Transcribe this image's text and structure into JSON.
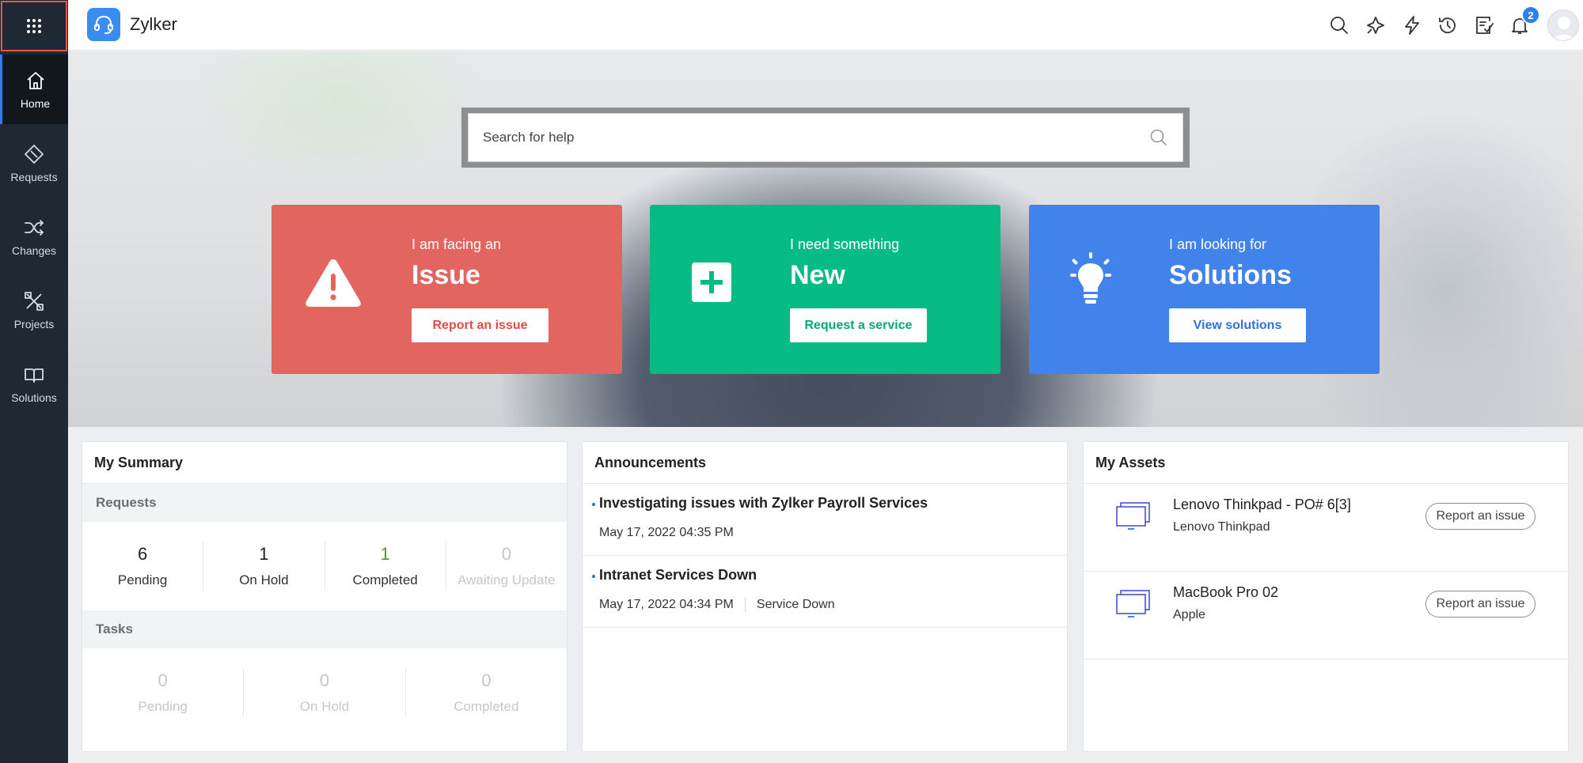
{
  "app": {
    "name": "Zylker"
  },
  "nav": {
    "items": [
      {
        "label": "Home",
        "icon": "home-icon"
      },
      {
        "label": "Requests",
        "icon": "ticket-icon"
      },
      {
        "label": "Changes",
        "icon": "shuffle-icon"
      },
      {
        "label": "Projects",
        "icon": "projects-icon"
      },
      {
        "label": "Solutions",
        "icon": "book-icon"
      }
    ],
    "active": "Home"
  },
  "header": {
    "icons": [
      "search-icon",
      "magic-icon",
      "lightning-icon",
      "history-icon",
      "checklist-icon",
      "bell-icon"
    ],
    "notifications_count": "2"
  },
  "search": {
    "placeholder": "Search for help"
  },
  "cards": [
    {
      "kicker": "I am facing an",
      "headline": "Issue",
      "button": "Report an issue",
      "icon": "warning-icon",
      "color": "#e26560"
    },
    {
      "kicker": "I need something",
      "headline": "New",
      "button": "Request a service",
      "icon": "plus-icon",
      "color": "#06bb84"
    },
    {
      "kicker": "I am looking for",
      "headline": "Solutions",
      "button": "View solutions",
      "icon": "bulb-icon",
      "color": "#4183ea"
    }
  ],
  "summary": {
    "title": "My Summary",
    "requests": {
      "label": "Requests",
      "stats": [
        {
          "value": "6",
          "label": "Pending"
        },
        {
          "value": "1",
          "label": "On Hold"
        },
        {
          "value": "1",
          "label": "Completed"
        },
        {
          "value": "0",
          "label": "Awaiting Update"
        }
      ]
    },
    "tasks": {
      "label": "Tasks",
      "stats": [
        {
          "value": "0",
          "label": "Pending"
        },
        {
          "value": "0",
          "label": "On Hold"
        },
        {
          "value": "0",
          "label": "Completed"
        }
      ]
    }
  },
  "announcements": {
    "title": "Announcements",
    "items": [
      {
        "title": "Investigating issues with Zylker Payroll Services",
        "date": "May 17, 2022 04:35 PM",
        "tag": ""
      },
      {
        "title": "Intranet Services Down",
        "date": "May 17, 2022 04:34 PM",
        "tag": "Service Down"
      }
    ]
  },
  "assets": {
    "title": "My Assets",
    "items": [
      {
        "name": "Lenovo Thinkpad - PO# 6[3]",
        "make": "Lenovo Thinkpad",
        "button": "Report an issue"
      },
      {
        "name": "MacBook Pro 02",
        "make": "Apple",
        "button": "Report an issue"
      }
    ]
  },
  "colors": {
    "accent": "#2f80ed",
    "nav_bg": "#1f2933",
    "highlight_border": "#e8564a"
  }
}
